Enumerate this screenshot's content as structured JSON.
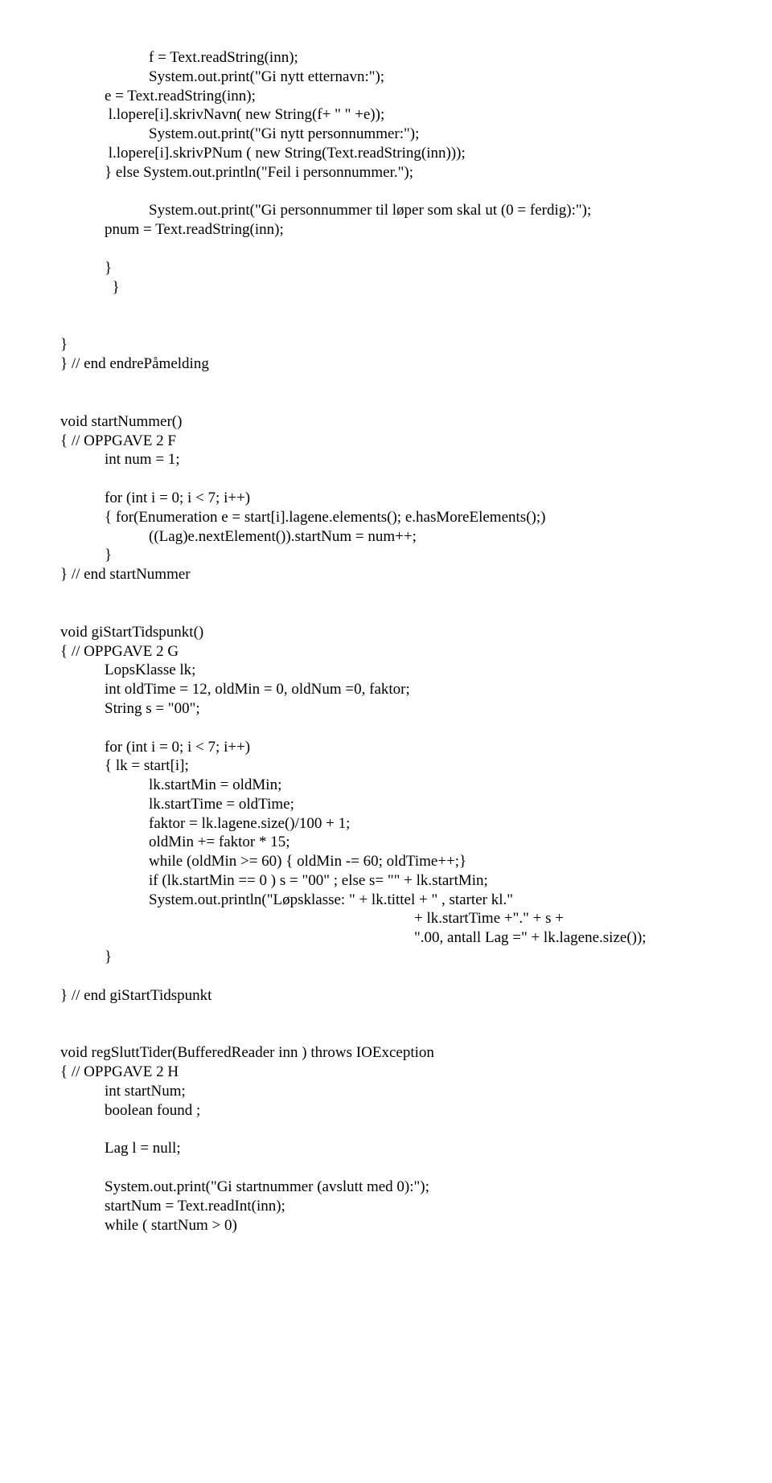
{
  "lines": [
    {
      "indent": 2,
      "text": "f = Text.readString(inn);"
    },
    {
      "indent": 2,
      "text": "System.out.print(\"Gi nytt etternavn:\");"
    },
    {
      "indent": 1,
      "text": "e = Text.readString(inn);"
    },
    {
      "indent": 1,
      "text": " l.lopere[i].skrivNavn( new String(f+ \" \" +e));"
    },
    {
      "indent": 2,
      "text": "System.out.print(\"Gi nytt personnummer:\");"
    },
    {
      "indent": 1,
      "text": " l.lopere[i].skrivPNum ( new String(Text.readString(inn)));"
    },
    {
      "indent": 1,
      "text": "} else System.out.println(\"Feil i personnummer.\");"
    },
    {
      "blank": true
    },
    {
      "indent": 2,
      "text": "System.out.print(\"Gi personnummer til løper som skal ut (0 = ferdig):\");"
    },
    {
      "indent": 1,
      "text": "pnum = Text.readString(inn);"
    },
    {
      "blank": true
    },
    {
      "indent": 1,
      "text": "}"
    },
    {
      "indent": 1,
      "text": "  }"
    },
    {
      "blank": true
    },
    {
      "blank": true
    },
    {
      "indent": 0,
      "text": "}"
    },
    {
      "indent": 0,
      "text": "} // end endrePåmelding"
    },
    {
      "blank": true
    },
    {
      "blank": true
    },
    {
      "indent": 0,
      "text": "void startNummer()"
    },
    {
      "indent": 0,
      "text": "{ // OPPGAVE 2 F"
    },
    {
      "indent": 1,
      "text": "int num = 1;"
    },
    {
      "blank": true
    },
    {
      "indent": 1,
      "text": "for (int i = 0; i < 7; i++)"
    },
    {
      "indent": 1,
      "text": "{ for(Enumeration e = start[i].lagene.elements(); e.hasMoreElements();)"
    },
    {
      "indent": 2,
      "text": "((Lag)e.nextElement()).startNum = num++;"
    },
    {
      "indent": 1,
      "text": "}"
    },
    {
      "indent": 0,
      "text": "} // end startNummer"
    },
    {
      "blank": true
    },
    {
      "blank": true
    },
    {
      "indent": 0,
      "text": "void giStartTidspunkt()"
    },
    {
      "indent": 0,
      "text": "{ // OPPGAVE 2 G"
    },
    {
      "indent": 1,
      "text": "LopsKlasse lk;"
    },
    {
      "indent": 1,
      "text": "int oldTime = 12, oldMin = 0, oldNum =0, faktor;"
    },
    {
      "indent": 1,
      "text": "String s = \"00\";"
    },
    {
      "blank": true
    },
    {
      "indent": 1,
      "text": "for (int i = 0; i < 7; i++)"
    },
    {
      "indent": 1,
      "text": "{ lk = start[i];"
    },
    {
      "indent": 2,
      "text": "lk.startMin = oldMin;"
    },
    {
      "indent": 2,
      "text": "lk.startTime = oldTime;"
    },
    {
      "indent": 2,
      "text": "faktor = lk.lagene.size()/100 + 1;"
    },
    {
      "indent": 2,
      "text": "oldMin += faktor * 15;"
    },
    {
      "indent": 2,
      "text": "while (oldMin >= 60) { oldMin -= 60; oldTime++;}"
    },
    {
      "indent": 2,
      "text": "if (lk.startMin == 0 ) s = \"00\" ; else s= \"\" + lk.startMin;"
    },
    {
      "indent": 2,
      "text": "System.out.println(\"Løpsklasse: \" + lk.tittel + \" , starter kl.\""
    },
    {
      "indent": 5,
      "text": "+ lk.startTime +\".\" + s +"
    },
    {
      "indent": 5,
      "text": "\".00, antall Lag =\" + lk.lagene.size());"
    },
    {
      "indent": 1,
      "text": "}"
    },
    {
      "blank": true
    },
    {
      "indent": 0,
      "text": "} // end giStartTidspunkt"
    },
    {
      "blank": true
    },
    {
      "blank": true
    },
    {
      "indent": 0,
      "text": "void regSluttTider(BufferedReader inn ) throws IOException"
    },
    {
      "indent": 0,
      "text": "{ // OPPGAVE 2 H"
    },
    {
      "indent": 1,
      "text": "int startNum;"
    },
    {
      "indent": 1,
      "text": "boolean found ;"
    },
    {
      "blank": true
    },
    {
      "indent": 1,
      "text": "Lag l = null;"
    },
    {
      "blank": true
    },
    {
      "indent": 1,
      "text": "System.out.print(\"Gi startnummer (avslutt med 0):\");"
    },
    {
      "indent": 1,
      "text": "startNum = Text.readInt(inn);"
    },
    {
      "indent": 1,
      "text": "while ( startNum > 0)"
    }
  ]
}
